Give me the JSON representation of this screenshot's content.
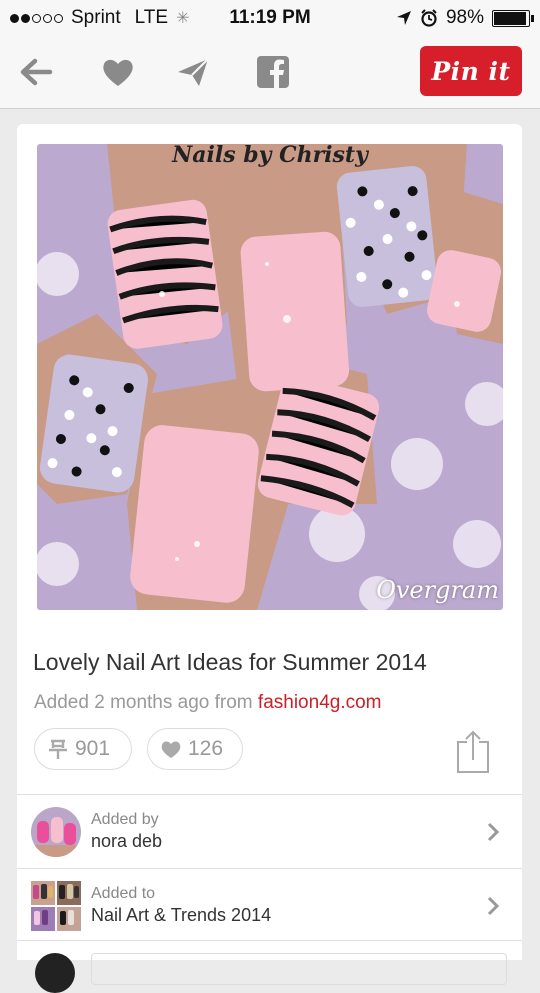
{
  "status": {
    "carrier": "Sprint",
    "network": "LTE",
    "time": "11:19 PM",
    "battery_percent": "98%",
    "battery_level": 0.98,
    "signal_bars_filled": 2,
    "signal_bars_total": 5
  },
  "toolbar": {
    "back_icon": "back-arrow-icon",
    "like_icon": "heart-icon",
    "send_icon": "send-icon",
    "facebook_icon": "facebook-icon",
    "pinit_label": "Pin it",
    "pinit_color": "#d71e2b"
  },
  "pin": {
    "image_watermark": "Nails by Christy",
    "image_credit": "Overgram",
    "title": "Lovely Nail Art Ideas for Summer 2014",
    "added_prefix": "Added 2 months ago from",
    "source": "fashion4g.com",
    "repin_count": "901",
    "like_count": "126",
    "share_icon": "share-icon"
  },
  "details": [
    {
      "label": "Added by",
      "value": "nora deb"
    },
    {
      "label": "Added to",
      "value": "Nail Art & Trends 2014"
    }
  ],
  "colors": {
    "accent": "#cb2027",
    "pink": "#f6b9c8",
    "lavender": "#bca9cf"
  }
}
